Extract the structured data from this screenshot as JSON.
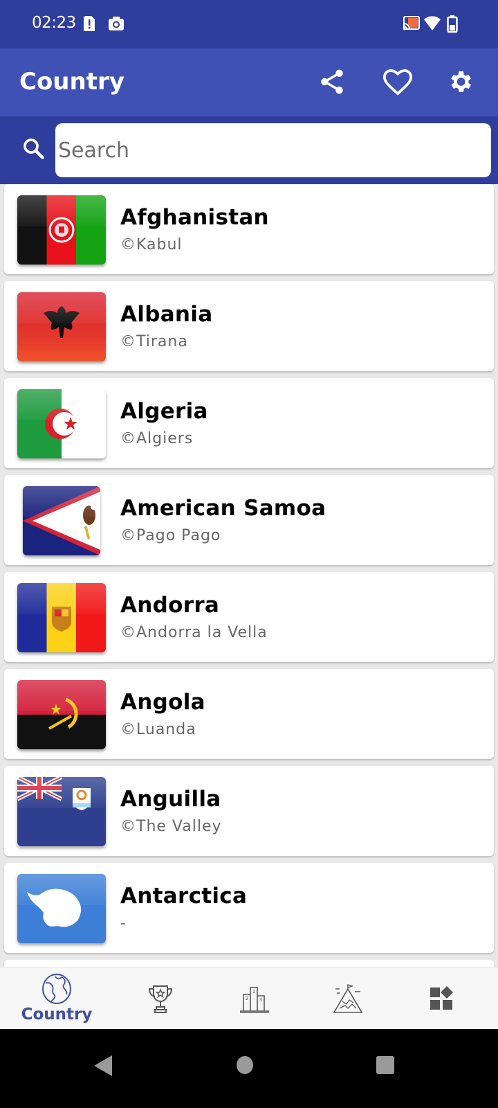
{
  "status_bar": {
    "time": "02:23",
    "icons": [
      "sim-alert-icon",
      "camera-icon",
      "cast-icon",
      "wifi-icon",
      "battery-icon"
    ]
  },
  "app_bar": {
    "title": "Country",
    "actions": [
      {
        "name": "share-icon",
        "label": "Share"
      },
      {
        "name": "heart-icon",
        "label": "Favorites"
      },
      {
        "name": "gear-icon",
        "label": "Settings"
      }
    ]
  },
  "search": {
    "placeholder": "Search",
    "value": ""
  },
  "countries": [
    {
      "name": "Afghanistan",
      "capital": "©Kabul",
      "flag": "afghanistan"
    },
    {
      "name": "Albania",
      "capital": "©Tirana",
      "flag": "albania"
    },
    {
      "name": "Algeria",
      "capital": "©Algiers",
      "flag": "algeria"
    },
    {
      "name": "American Samoa",
      "capital": "©Pago Pago",
      "flag": "american-samoa"
    },
    {
      "name": "Andorra",
      "capital": "©Andorra la Vella",
      "flag": "andorra"
    },
    {
      "name": "Angola",
      "capital": "©Luanda",
      "flag": "angola"
    },
    {
      "name": "Anguilla",
      "capital": "©The Valley",
      "flag": "anguilla"
    },
    {
      "name": "Antarctica",
      "capital": "-",
      "flag": "antarctica"
    }
  ],
  "bottom_nav": {
    "items": [
      {
        "name": "globe-icon",
        "label": "Country",
        "active": true
      },
      {
        "name": "trophy-icon",
        "label": "",
        "active": false
      },
      {
        "name": "podium-icon",
        "label": "",
        "active": false
      },
      {
        "name": "mountain-icon",
        "label": "",
        "active": false
      },
      {
        "name": "apps-icon",
        "label": "",
        "active": false
      }
    ]
  },
  "colors": {
    "primary": "#3f51b5",
    "primary_dark": "#2f3d9c",
    "nav_active": "#3f4fa3"
  }
}
